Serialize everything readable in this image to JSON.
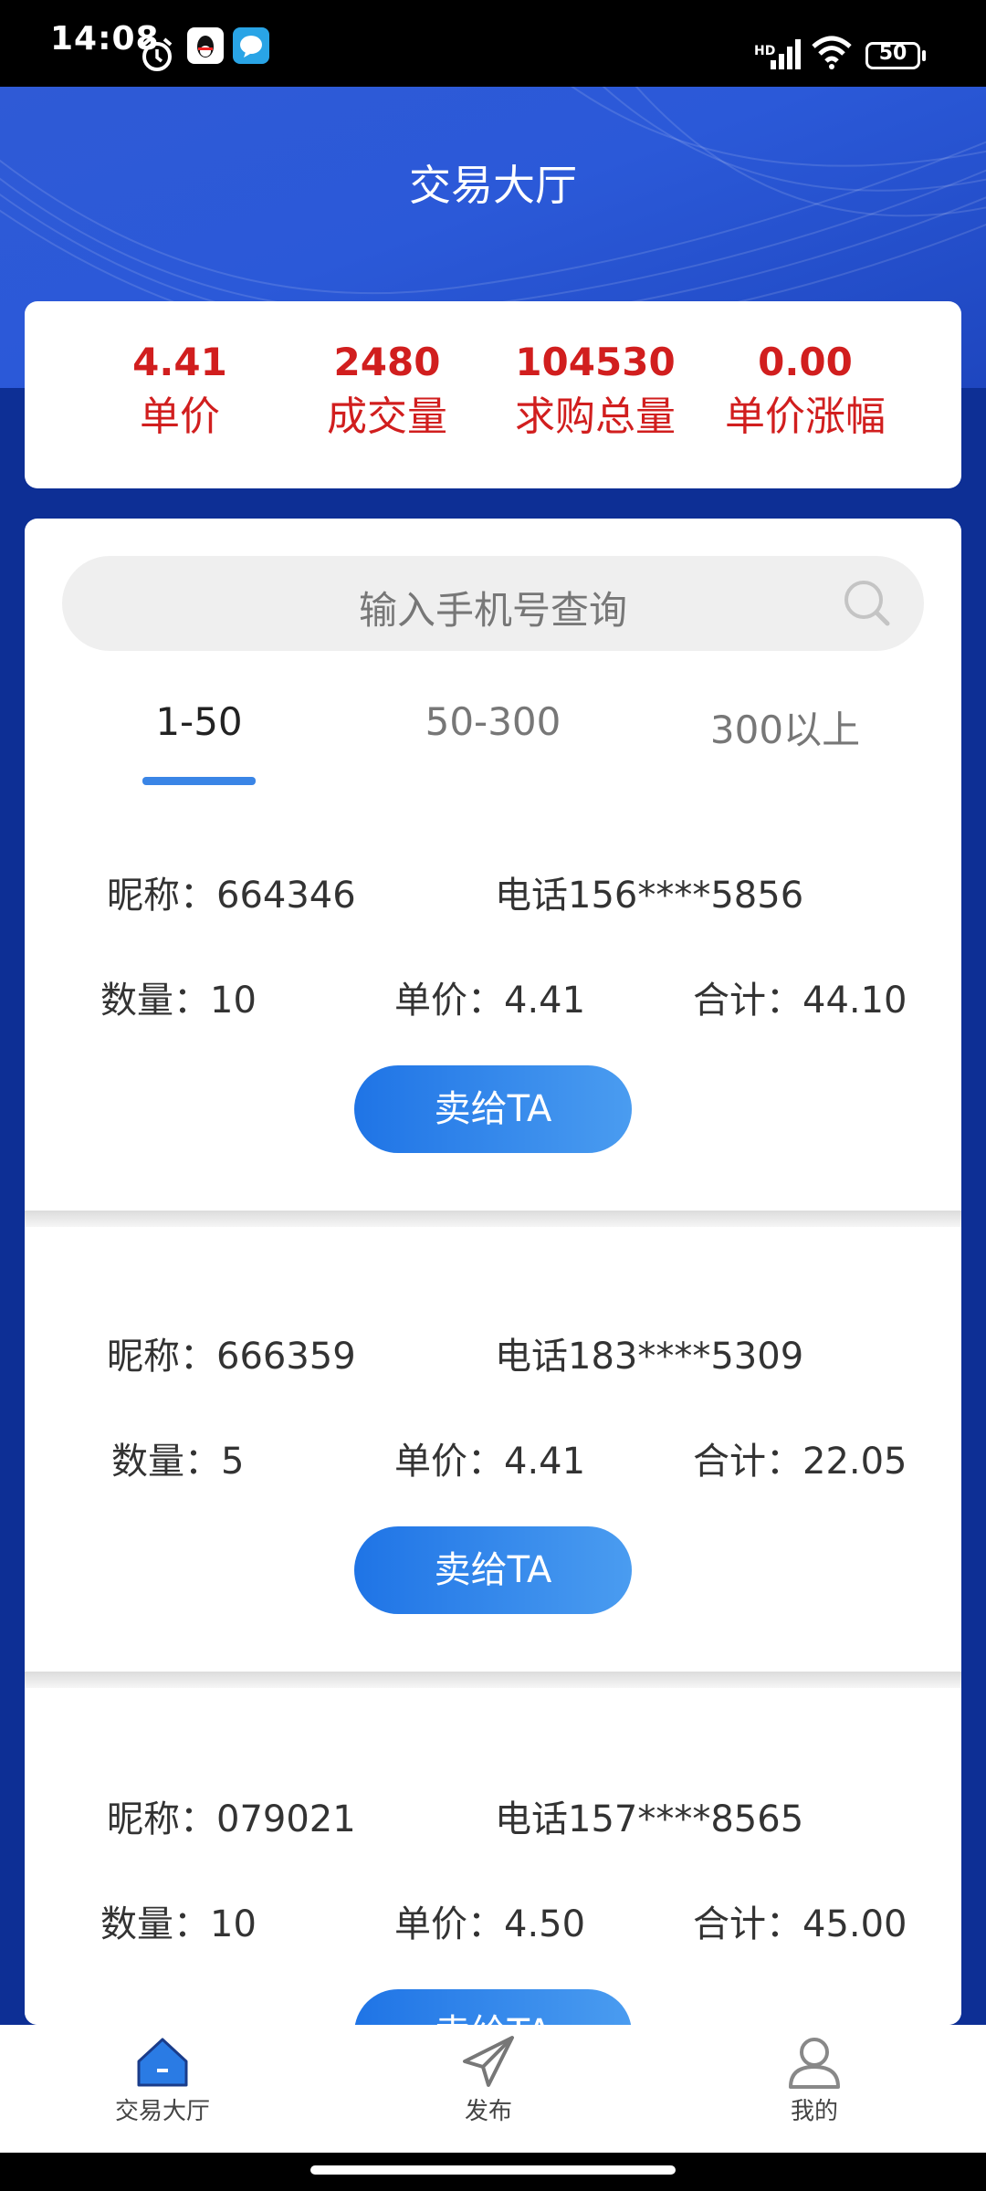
{
  "status_bar": {
    "time": "14:08",
    "battery": "50",
    "network": "HD",
    "icons": [
      "alarm-icon",
      "qq-icon",
      "message-app-icon",
      "signal-icon",
      "wifi-icon",
      "battery-icon"
    ]
  },
  "header": {
    "title": "交易大厅"
  },
  "stats": [
    {
      "value": "4.41",
      "label": "单价"
    },
    {
      "value": "2480",
      "label": "成交量"
    },
    {
      "value": "104530",
      "label": "求购总量"
    },
    {
      "value": "0.00",
      "label": "单价涨幅"
    }
  ],
  "search": {
    "placeholder": "输入手机号查询"
  },
  "tabs": [
    {
      "label": "1-50",
      "active": true
    },
    {
      "label": "50-300",
      "active": false
    },
    {
      "label": "300以上",
      "active": false
    }
  ],
  "listings": [
    {
      "nickname": "昵称：664346",
      "phone": "电话156****5856",
      "quantity": "数量：10",
      "price": "单价：4.41",
      "total": "合计：44.10",
      "button": "卖给TA"
    },
    {
      "nickname": "昵称：666359",
      "phone": "电话183****5309",
      "quantity": "数量：5",
      "price": "单价：4.41",
      "total": "合计：22.05",
      "button": "卖给TA"
    },
    {
      "nickname": "昵称：079021",
      "phone": "电话157****8565",
      "quantity": "数量：10",
      "price": "单价：4.50",
      "total": "合计：45.00",
      "button": "卖给TA"
    }
  ],
  "bottom_nav": [
    {
      "label": "交易大厅",
      "icon": "home-icon",
      "active": true
    },
    {
      "label": "发布",
      "icon": "send-icon",
      "active": false
    },
    {
      "label": "我的",
      "icon": "user-icon",
      "active": false
    }
  ],
  "colors": {
    "accent": "#3a85e6",
    "stat_red": "#d11e1e",
    "header_blue": "#2b59d8",
    "page_bg": "#0d2f95"
  }
}
